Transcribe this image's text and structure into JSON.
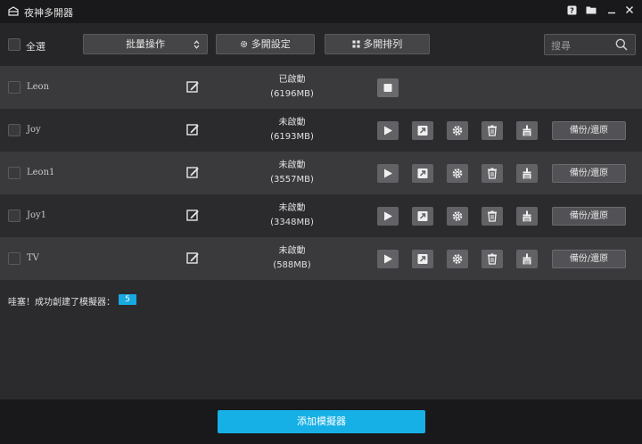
{
  "window": {
    "title": "夜神多開器"
  },
  "toolbar": {
    "select_all_label": "全選",
    "batch_label": "批量操作",
    "settings_label": "多開設定",
    "arrange_label": "多開排列",
    "search_placeholder": "搜尋"
  },
  "instances": [
    {
      "name": "Leon",
      "status": "已啟動",
      "memory": "(6196MB)",
      "running": true
    },
    {
      "name": "Joy",
      "status": "未啟動",
      "memory": "(6193MB)",
      "running": false,
      "backup_label": "備份/還原"
    },
    {
      "name": "Leon1",
      "status": "未啟動",
      "memory": "(3557MB)",
      "running": false,
      "backup_label": "備份/還原"
    },
    {
      "name": "Joy1",
      "status": "未啟動",
      "memory": "(3348MB)",
      "running": false,
      "backup_label": "備份/還原"
    },
    {
      "name": "TV",
      "status": "未啟動",
      "memory": "(588MB)",
      "running": false,
      "backup_label": "備份/還原"
    }
  ],
  "message": {
    "text": "哇塞！成功創建了模擬器：",
    "count": "5"
  },
  "footer": {
    "add_label": "添加模擬器"
  },
  "colors": {
    "accent": "#17b0e6",
    "badge": "#17a9e0"
  }
}
